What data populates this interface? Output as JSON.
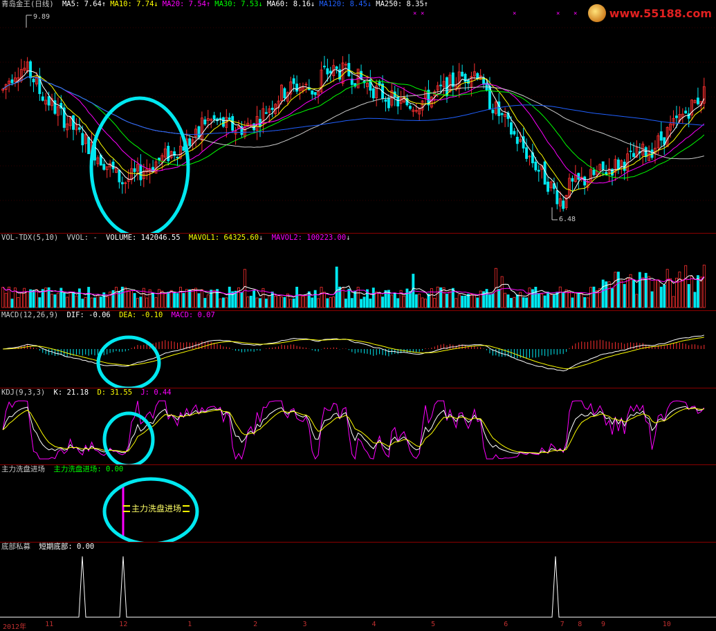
{
  "price_header": {
    "title": "青岛金王(日线)",
    "items": [
      {
        "label": "MA5:",
        "value": "7.64",
        "arrow": "↑",
        "color": "#ffffff"
      },
      {
        "label": "MA10:",
        "value": "7.74",
        "arrow": "↓",
        "color": "#ffff00"
      },
      {
        "label": "MA20:",
        "value": "7.54",
        "arrow": "↑",
        "color": "#ff00ff"
      },
      {
        "label": "MA30:",
        "value": "7.53",
        "arrow": "↓",
        "color": "#00ff00"
      },
      {
        "label": "MA60:",
        "value": "8.16",
        "arrow": "↓",
        "color": "#ffffff"
      },
      {
        "label": "MA120:",
        "value": "8.45",
        "arrow": "↓",
        "color": "#2060ff"
      },
      {
        "label": "MA250:",
        "value": "8.35",
        "arrow": "↑",
        "color": "#ffffff"
      }
    ],
    "high_label": "9.89",
    "low_label": "6.48"
  },
  "volume_header": {
    "name": "VOL-TDX(5,10)",
    "vvol": "VVOL: -",
    "volume": "VOLUME: 142046.55",
    "mavol1": "MAVOL1: 64325.60",
    "mavol2": "MAVOL2: 100223.00"
  },
  "macd_header": {
    "name": "MACD(12,26,9)",
    "dif": "DIF: -0.06",
    "dea": "DEA: -0.10",
    "macd": "MACD: 0.07"
  },
  "kdj_header": {
    "name": "KDJ(9,3,3)",
    "k": "K: 21.18",
    "d": "D: 31.55",
    "j": "J: 0.44"
  },
  "wash_header": {
    "name": "主力洗盘进场",
    "value_label": "主力洗盘进场: 0.00",
    "signal_label": "主力洗盘进场"
  },
  "bottom_header": {
    "name": "底部私募",
    "value_label": "短期底部: 0.00"
  },
  "watermark": {
    "text": "www.55188.com"
  },
  "x_axis": {
    "ticks": [
      {
        "label": "2012年",
        "pos": 0.0
      },
      {
        "label": "11",
        "pos": 0.06
      },
      {
        "label": "12",
        "pos": 0.165
      },
      {
        "label": "1",
        "pos": 0.262
      },
      {
        "label": "2",
        "pos": 0.355
      },
      {
        "label": "3",
        "pos": 0.425
      },
      {
        "label": "4",
        "pos": 0.523
      },
      {
        "label": "5",
        "pos": 0.607
      },
      {
        "label": "6",
        "pos": 0.71
      },
      {
        "label": "7",
        "pos": 0.79
      },
      {
        "label": "8",
        "pos": 0.815
      },
      {
        "label": "9",
        "pos": 0.848
      },
      {
        "label": "10",
        "pos": 0.935
      }
    ]
  },
  "colors": {
    "up": "#ff3030",
    "down": "#00e8f0",
    "ma5": "#ffffff",
    "ma10": "#ffff00",
    "ma20": "#ff00ff",
    "ma30": "#00ff00",
    "ma120": "#2060ff",
    "highlight_circle": "#00e8f0",
    "divider": "#8b0000"
  }
}
